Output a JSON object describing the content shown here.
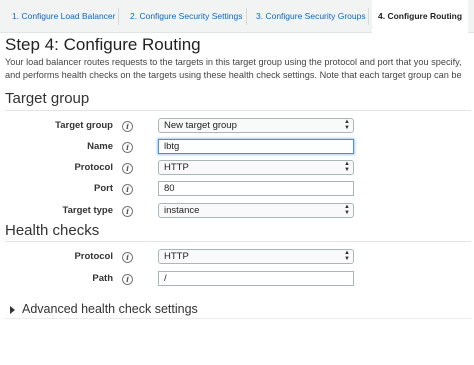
{
  "tabs": [
    {
      "label": "1. Configure Load Balancer",
      "active": false
    },
    {
      "label": "2. Configure Security Settings",
      "active": false
    },
    {
      "label": "3. Configure Security Groups",
      "active": false
    },
    {
      "label": "4. Configure Routing",
      "active": true
    }
  ],
  "step": {
    "title": "Step 4: Configure Routing",
    "description": "Your load balancer routes requests to the targets in this target group using the protocol and port that you specify, and performs health checks on the targets using these health check settings. Note that each target group can be associated with only one load balancer."
  },
  "target_group": {
    "heading": "Target group",
    "target_group_label": "Target group",
    "target_group_value": "New target group",
    "name_label": "Name",
    "name_value": "lbtg",
    "protocol_label": "Protocol",
    "protocol_value": "HTTP",
    "port_label": "Port",
    "port_value": "80",
    "target_type_label": "Target type",
    "target_type_value": "instance"
  },
  "health_checks": {
    "heading": "Health checks",
    "protocol_label": "Protocol",
    "protocol_value": "HTTP",
    "path_label": "Path",
    "path_value": "/"
  },
  "advanced": {
    "label": "Advanced health check settings"
  },
  "icons": {
    "info": "i",
    "select_arrows_up": "▲",
    "select_arrows_down": "▼"
  },
  "colors": {
    "link": "#1166bb",
    "focus_border": "#4a90d9"
  }
}
